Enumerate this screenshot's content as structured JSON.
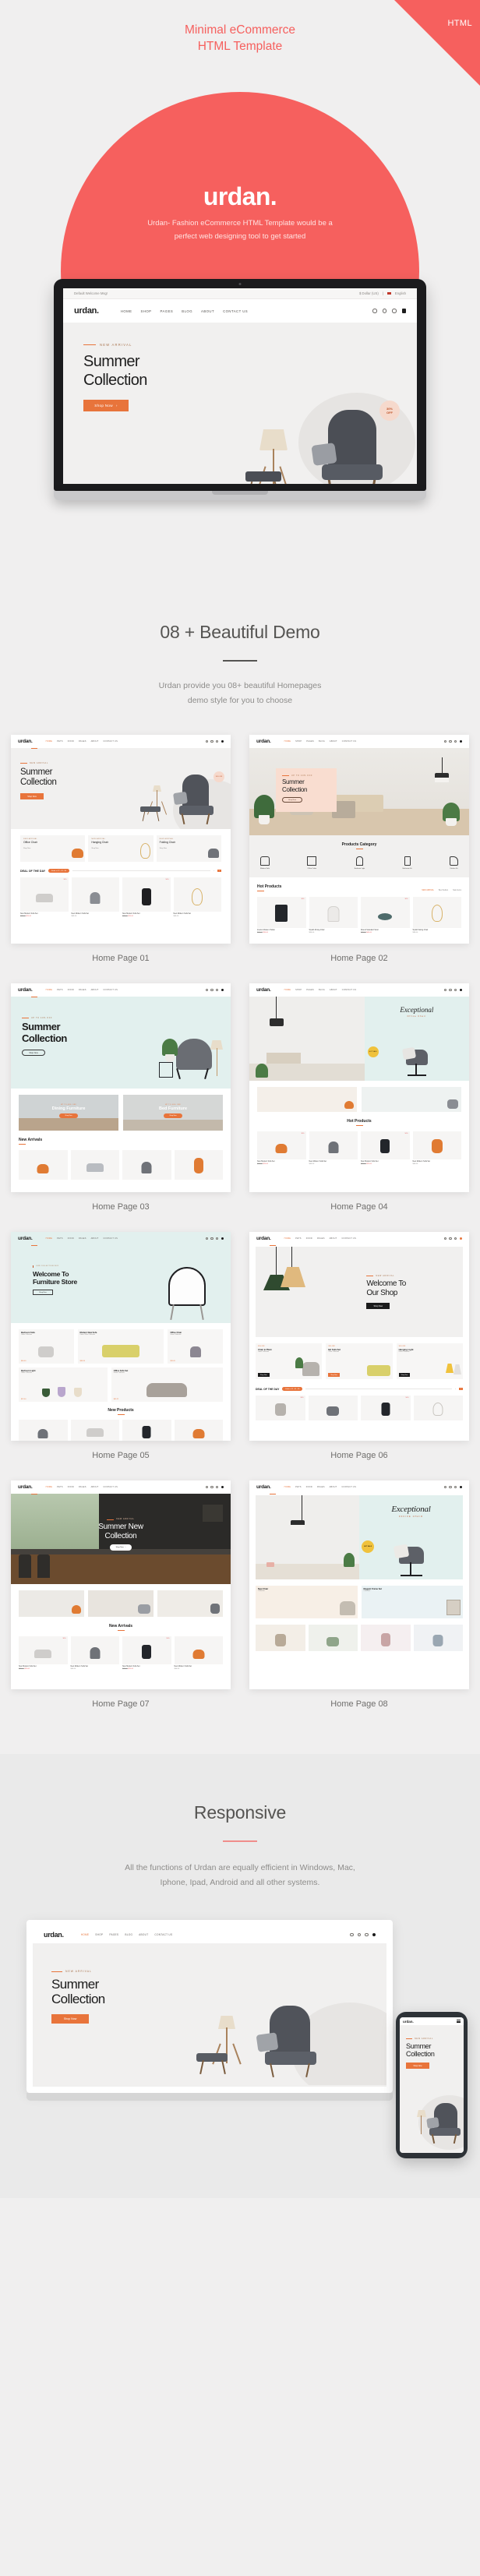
{
  "badge": {
    "label": "HTML"
  },
  "hero": {
    "title_line1": "Minimal eCommerce",
    "title_line2": "HTML Template",
    "logo": "urdan.",
    "sub_line1": "Urdan- Fashion eCommerce HTML Template would be a",
    "sub_line2": "perfect web designing tool to get started",
    "accent_color": "#f6605e",
    "mockup": {
      "welcome_msg": "Default Welcome Msg!",
      "currency": "$ Dollar (US)",
      "language": "English",
      "brand": "urdan.",
      "nav": [
        "HOME",
        "SHOP",
        "PAGES",
        "BLOG",
        "ABOUT",
        "CONTACT US"
      ],
      "eyebrow": "NEW ARRIVAL",
      "headline_line1": "Summer",
      "headline_line2": "Collection",
      "cta": "Shop Now",
      "discount_line1": "30%",
      "discount_line2": "OFF"
    }
  },
  "demos": {
    "title": "08 + Beautiful Demo",
    "sub_line1": "Urdan  provide you 08+ beautiful Homepages",
    "sub_line2": "demo style for you to choose",
    "items": [
      {
        "label": "Home Page 01",
        "brand": "urdan.",
        "nav": [
          "HOME",
          "PETS",
          "FOOD",
          "PAGES",
          "ABOUT",
          "CONTACT US"
        ],
        "eyebrow": "NEW ARRIVAL",
        "headline_line1": "Summer",
        "headline_line2": "Collection",
        "cta": "Shop Now",
        "badge": "30% OFF",
        "promo_cards": [
          {
            "eyebrow": "NEW ARRIVAL",
            "title": "Office Chair",
            "link": "Shop Now"
          },
          {
            "eyebrow": "NEW ARRIVAL",
            "title": "Hanging Chair",
            "link": "Shop Now"
          },
          {
            "eyebrow": "NEW ARRIVAL",
            "title": "Folding Chair",
            "link": "Shop Now"
          }
        ],
        "deal_title": "DEAL OF THE DAY",
        "deal_timer": "Ends in 12 : 41 : 56",
        "products": [
          {
            "name": "New Modern Sofa Set",
            "price": "$29.00",
            "sale": "$25.00",
            "tag": "30%"
          },
          {
            "name": "New Modern Sofa Set",
            "price": "$45.00",
            "sale": "",
            "tag": ""
          },
          {
            "name": "New Modern Sofa Set",
            "price": "$29.00",
            "sale": "$25.00",
            "tag": "50%"
          },
          {
            "name": "New Modern Sofa Set",
            "price": "$40.00",
            "sale": "",
            "tag": ""
          }
        ]
      },
      {
        "label": "Home Page 02",
        "brand": "urdan.",
        "nav": [
          "HOME",
          "SHOP",
          "PAGES",
          "BLOG",
          "ABOUT",
          "CONTACT US"
        ],
        "eyebrow": "UP TO 40% OFF",
        "headline_line1": "Summer",
        "headline_line2": "Collection",
        "cta": "Shop Now",
        "category_title": "Products Category",
        "categories": [
          "Modern Sofa",
          "Office Cabin",
          "Bedroom Light",
          "Bathroom Kit",
          "Kitchen Kit"
        ],
        "hot_title": "Hot Products",
        "hot_tabs": [
          "NEW ARRIVAL",
          "Best Sellers",
          "Sale Items"
        ],
        "products": [
          {
            "name": "Interior Modern Holder",
            "price": "$45.00",
            "sale": "$35.00",
            "tag": "30%"
          },
          {
            "name": "Stylish Dining Chair",
            "price": "$50.00",
            "sale": "",
            "tag": ""
          },
          {
            "name": "Round Standard Stool",
            "price": "$48.00",
            "sale": "$40.00",
            "tag": "30%"
          },
          {
            "name": "Stylish Swing Chair",
            "price": "$30.00",
            "sale": "",
            "tag": ""
          }
        ]
      },
      {
        "label": "Home Page 03",
        "brand": "urdan.",
        "nav": [
          "HOME",
          "PETS",
          "FOOD",
          "PAGES",
          "ABOUT",
          "CONTACT US"
        ],
        "eyebrow": "UP TO 40% OFF",
        "headline_line1": "Summer",
        "headline_line2": "Collection",
        "cta": "Shop Now",
        "banners": [
          {
            "eyebrow": "UP TO 40% OFF",
            "title": "Dining Furniture",
            "cta": "Shop Now"
          },
          {
            "eyebrow": "UP TO 40% OFF",
            "title": "Bed Furniture",
            "cta": "Shop Now"
          }
        ],
        "section_title": "New Arrivals"
      },
      {
        "label": "Home Page 04",
        "brand": "urdan.",
        "nav": [
          "HOME",
          "SHOP",
          "PAGES",
          "BLOG",
          "ABOUT",
          "CONTACT US"
        ],
        "eyebrow": "NEW COLLECTION",
        "headline_line1": "Exceptional",
        "headline_line2": "Office Chair",
        "cta": "Shop Now",
        "hot_title": "Hot Products",
        "products": [
          {
            "name": "New Modern Sofa Set",
            "price": "$29.00",
            "sale": "$25.00",
            "tag": "30%"
          },
          {
            "name": "New Modern Sofa Set",
            "price": "$45.00",
            "sale": "",
            "tag": ""
          },
          {
            "name": "New Modern Sofa Set",
            "price": "$29.00",
            "sale": "$25.00",
            "tag": "50%"
          },
          {
            "name": "New Modern Sofa Set",
            "price": "$40.00",
            "sale": "",
            "tag": ""
          }
        ]
      },
      {
        "label": "Home Page 05",
        "brand": "urdan.",
        "nav": [
          "HOME",
          "PETS",
          "FOOD",
          "PAGES",
          "ABOUT",
          "CONTACT US"
        ],
        "eyebrow": "OUR COLLECTION 2021",
        "headline_line1": "Welcome To",
        "headline_line2": "Furniture Store",
        "cta": "Shop Now",
        "promo_cards": [
          {
            "title": "Bedroom Sofa",
            "sub": "Urban Collection",
            "price": "$66.00"
          },
          {
            "title": "Modern New Sofa",
            "sub": "Urban Office Collection",
            "price": "$80.34"
          },
          {
            "title": "Office Chair",
            "sub": "Urban Collection",
            "price": "$20.09"
          },
          {
            "title": "Bedroom Light",
            "sub": "Urban Collection",
            "price": "$22.00"
          },
          {
            "title": "Office Sofa Set",
            "sub": "Urban Collection",
            "price": "$89.22"
          }
        ],
        "section_title": "New Products"
      },
      {
        "label": "Home Page 06",
        "brand": "urdan.",
        "nav": [
          "HOME",
          "PETS",
          "FOOD",
          "PAGES",
          "ABOUT",
          "CONTACT US"
        ],
        "eyebrow": "NEW ARRIVAL",
        "headline_line1": "Welcome To",
        "headline_line2": "Our Shop",
        "cta": "Shop Now",
        "promo_cards": [
          {
            "eyebrow": "30% OFF",
            "title": "Chair & Plant",
            "sub": "Urban Collection",
            "cta": "Shop Now"
          },
          {
            "eyebrow": "30% OFF",
            "title": "Bd Sofa Set",
            "sub": "Office Collection",
            "cta": "Shop Now"
          },
          {
            "eyebrow": "30% OFF",
            "title": "Hanging Light",
            "sub": "Urban Collection",
            "cta": "Shop Now"
          }
        ],
        "deal_title": "DEAL OF THE DAY",
        "deal_timer": "Ends in 12 : 41 : 56"
      },
      {
        "label": "Home Page 07",
        "brand": "urdan.",
        "nav": [
          "HOME",
          "PETS",
          "FOOD",
          "PAGES",
          "ABOUT",
          "CONTACT US"
        ],
        "eyebrow": "NEW ARRIVAL",
        "headline_line1": "Summer New",
        "headline_line2": "Collection",
        "cta": "Shop Now",
        "section_title": "New Arrivals",
        "products": [
          {
            "name": "New Modern Sofa Set",
            "price": "$29.00",
            "sale": "$25.00",
            "tag": "30%"
          },
          {
            "name": "New Modern Sofa Set",
            "price": "$45.00",
            "sale": "",
            "tag": ""
          },
          {
            "name": "New Modern Sofa Set",
            "price": "$29.00",
            "sale": "$25.00",
            "tag": "50%"
          },
          {
            "name": "New Modern Sofa Set",
            "price": "$40.00",
            "sale": "",
            "tag": ""
          }
        ]
      },
      {
        "label": "Home Page 08",
        "brand": "urdan.",
        "nav": [
          "HOME",
          "PETS",
          "FOOD",
          "PAGES",
          "ABOUT",
          "CONTACT US"
        ],
        "eyebrow": "OFFICE CHAIR",
        "headline_line1": "Exceptional",
        "headline_line2": "",
        "cta": "Shop Now",
        "badge": "HOT SALE",
        "banners": [
          {
            "title": "New Chair",
            "sub": "Collection"
          },
          {
            "title": "Elegant Frame Set",
            "sub": "Collection"
          }
        ]
      }
    ]
  },
  "responsive": {
    "title": "Responsive",
    "sub_line1": "All the functions of Urdan  are equally efficient in Windows, Mac,",
    "sub_line2": "Iphone, Ipad, Android and all other systems.",
    "accent_color": "#f08d8b",
    "desktop": {
      "brand": "urdan.",
      "nav": [
        "HOME",
        "SHOP",
        "PAGES",
        "BLOG",
        "ABOUT",
        "CONTACT US"
      ],
      "eyebrow": "NEW ARRIVAL",
      "headline_line1": "Summer",
      "headline_line2": "Collection",
      "cta": "Shop Now"
    },
    "mobile": {
      "brand": "urdan.",
      "eyebrow": "NEW ARRIVAL",
      "headline_line1": "Summer",
      "headline_line2": "Collection",
      "cta": "Shop Now"
    }
  }
}
